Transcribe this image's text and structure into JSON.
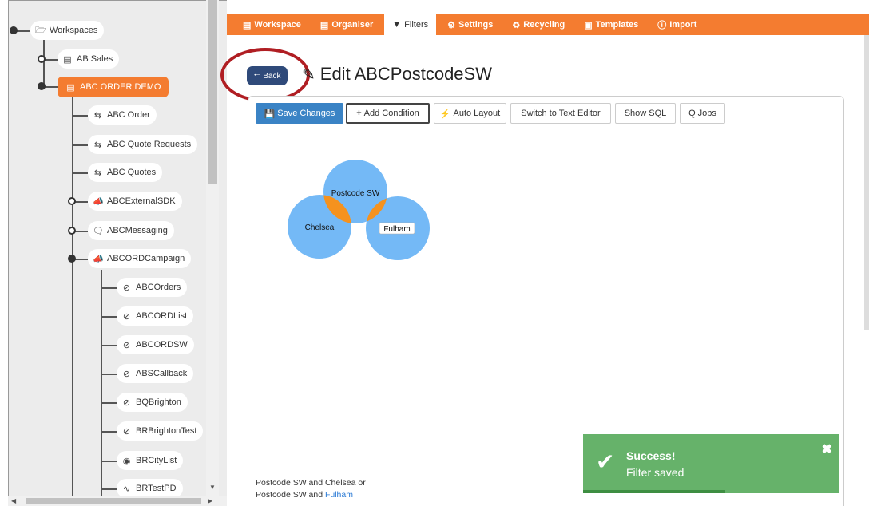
{
  "tree": {
    "root": "Workspaces",
    "items": [
      {
        "label": "AB Sales",
        "icon": "workspace-icon"
      },
      {
        "label": "ABC ORDER DEMO",
        "icon": "workspace-icon",
        "active": true
      },
      {
        "label": "ABC Order",
        "icon": "sync-arrows-icon"
      },
      {
        "label": "ABC Quote Requests",
        "icon": "sync-arrows-icon"
      },
      {
        "label": "ABC Quotes",
        "icon": "sync-arrows-icon"
      },
      {
        "label": "ABCExternalSDK",
        "icon": "megaphone-icon"
      },
      {
        "label": "ABCMessaging",
        "icon": "messaging-icon"
      },
      {
        "label": "ABCORDCampaign",
        "icon": "megaphone-icon"
      },
      {
        "label": "ABCOrders",
        "icon": "eye-slash-icon"
      },
      {
        "label": "ABCORDList",
        "icon": "eye-slash-icon"
      },
      {
        "label": "ABCORDSW",
        "icon": "eye-slash-icon"
      },
      {
        "label": "ABSCallback",
        "icon": "eye-slash-icon"
      },
      {
        "label": "BQBrighton",
        "icon": "eye-slash-icon"
      },
      {
        "label": "BRBrightonTest",
        "icon": "eye-slash-icon"
      },
      {
        "label": "BRCityList",
        "icon": "eye-icon"
      },
      {
        "label": "BRTestPD",
        "icon": "chart-line-icon"
      }
    ]
  },
  "nav": {
    "tabs": [
      {
        "label": "Workspace",
        "icon": "workspace-icon"
      },
      {
        "label": "Organiser",
        "icon": "book-icon"
      },
      {
        "label": "Filters",
        "icon": "filter-icon",
        "active": true
      },
      {
        "label": "Settings",
        "icon": "gear-icon"
      },
      {
        "label": "Recycling",
        "icon": "recycle-icon"
      },
      {
        "label": "Templates",
        "icon": "templates-icon"
      },
      {
        "label": "Import",
        "icon": "import-icon"
      }
    ]
  },
  "header": {
    "back_label": "Back",
    "title": "Edit ABCPostcodeSW"
  },
  "toolbar": {
    "save": "Save Changes",
    "add_condition": "Add Condition",
    "auto_layout": "Auto Layout",
    "text_editor": "Switch to Text Editor",
    "show_sql": "Show SQL",
    "q_jobs": "Q Jobs"
  },
  "venn": {
    "sets": [
      "Postcode SW",
      "Chelsea",
      "Fulham"
    ],
    "color_circle": "#74b9f6",
    "color_overlap": "#f5921e"
  },
  "summary": {
    "line1": "Postcode SW and Chelsea or",
    "line2_prefix": "Postcode SW and ",
    "line2_link": "Fulham"
  },
  "toast": {
    "title": "Success!",
    "message": "Filter saved",
    "color": "#66b26a"
  }
}
